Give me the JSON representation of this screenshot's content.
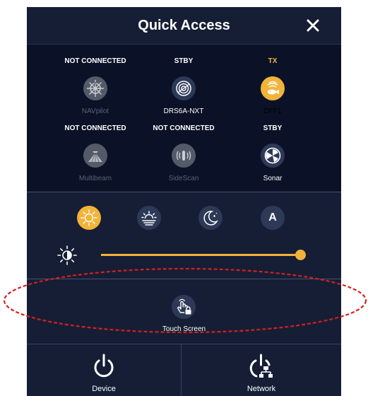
{
  "panel": {
    "title": "Quick Access"
  },
  "devices": [
    {
      "status": "NOT CONNECTED",
      "name": "NAVpilot",
      "icon": "helm-icon",
      "state": "dim"
    },
    {
      "status": "STBY",
      "name": "DRS6A-NXT",
      "icon": "radar-icon",
      "state": "ok"
    },
    {
      "status": "TX",
      "name": "DFF1",
      "icon": "fish-finder-icon",
      "state": "tx"
    },
    {
      "status": "NOT CONNECTED",
      "name": "Multibeam",
      "icon": "multibeam-icon",
      "state": "dim"
    },
    {
      "status": "NOT CONNECTED",
      "name": "SideScan",
      "icon": "sidescan-icon",
      "state": "dim"
    },
    {
      "status": "STBY",
      "name": "Sonar",
      "icon": "sonar-icon",
      "state": "ok"
    }
  ],
  "display_modes": {
    "selected": "day",
    "items": [
      {
        "id": "day",
        "icon": "sun-icon"
      },
      {
        "id": "dusk",
        "icon": "sunset-icon"
      },
      {
        "id": "night",
        "icon": "moon-icon"
      },
      {
        "id": "auto",
        "icon": "auto-icon",
        "letter": "A"
      }
    ]
  },
  "brightness": {
    "icon": "brightness-icon",
    "level": 1.0
  },
  "touch_screen": {
    "label": "Touch Screen",
    "icon": "touch-lock-icon"
  },
  "bottom_buttons": {
    "device": "Device",
    "network": "Network"
  },
  "colors": {
    "accent": "#f2b33a",
    "panel_bg": "#151e35",
    "section_bg": "#0b1227",
    "highlight_ellipse": "#d42020"
  }
}
